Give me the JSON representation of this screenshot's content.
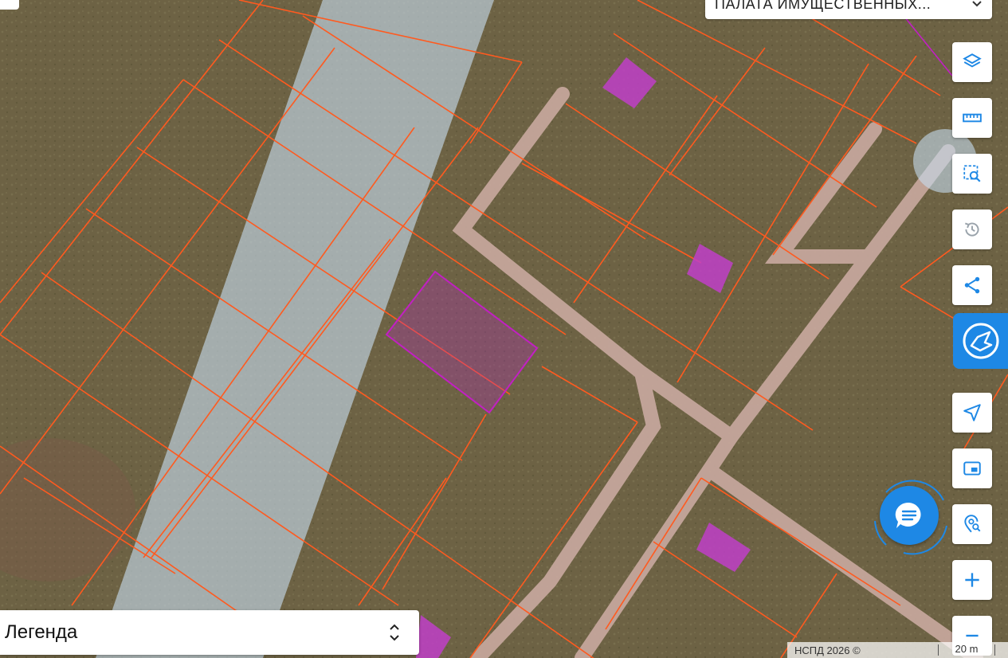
{
  "top_select": {
    "value": "ПАЛАТА ИМУЩЕСТВЕННЫХ..."
  },
  "legend": {
    "label": "Легенда"
  },
  "attribution": {
    "text": "НСПД 2026 ©",
    "scale": "20 m"
  },
  "toolbar": {
    "icons": [
      "layers-icon",
      "ruler-icon",
      "area-search-icon",
      "history-icon",
      "share-icon",
      "send-location-icon",
      "picture-in-picture-icon",
      "map-pin-search-icon",
      "zoom-in-icon",
      "zoom-out-icon"
    ]
  },
  "colors": {
    "accent": "#1e88e5",
    "parcel_border": "#ff5a1f",
    "selected_parcel": "#c21fc4",
    "building": "#c040c8",
    "zone": "#c7dcee",
    "road": "#c9aaa0"
  }
}
